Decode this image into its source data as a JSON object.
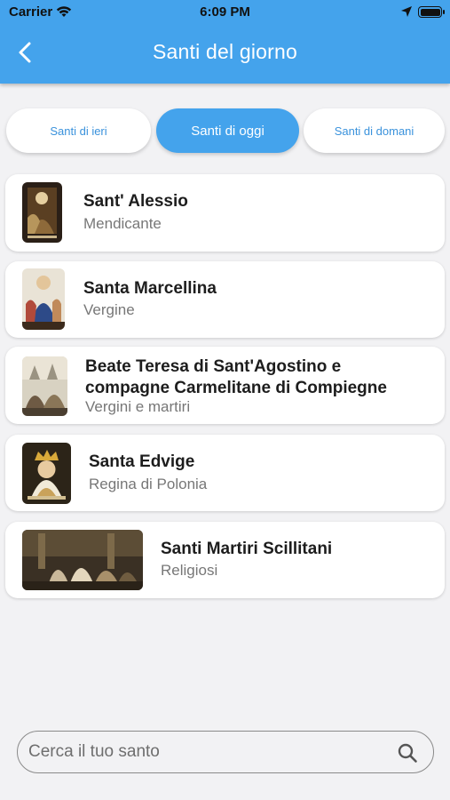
{
  "status_bar": {
    "carrier": "Carrier",
    "time": "6:09 PM"
  },
  "header": {
    "title": "Santi del giorno"
  },
  "tabs": [
    {
      "label": "Santi di ieri",
      "active": false
    },
    {
      "label": "Santi di oggi",
      "active": true
    },
    {
      "label": "Santi di domani",
      "active": false
    }
  ],
  "saints": [
    {
      "name": "Sant' Alessio",
      "description": "Mendicante"
    },
    {
      "name": "Santa Marcellina",
      "description": "Vergine"
    },
    {
      "name_line1": "Beate Teresa di Sant'Agostino e",
      "name_line2": "compagne Carmelitane di Compiegne",
      "description": "Vergini e martiri"
    },
    {
      "name": "Santa Edvige",
      "description": "Regina di Polonia"
    },
    {
      "name": "Santi Martiri Scillitani",
      "description": "Religiosi"
    }
  ],
  "search": {
    "placeholder": "Cerca il tuo santo",
    "value": ""
  },
  "colors": {
    "accent": "#44a3ec",
    "accent_text": "#3a92dc",
    "background": "#f2f2f4"
  }
}
